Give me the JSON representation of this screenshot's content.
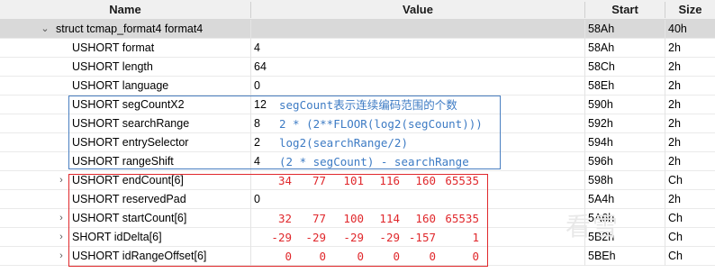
{
  "columns": {
    "name": "Name",
    "value": "Value",
    "start": "Start",
    "size": "Size"
  },
  "rows": [
    {
      "name": "struct tcmap_format4 format4",
      "value": "",
      "start": "58Ah",
      "size": "40h"
    },
    {
      "name": "USHORT format",
      "value": "4",
      "start": "58Ah",
      "size": "2h"
    },
    {
      "name": "USHORT length",
      "value": "64",
      "start": "58Ch",
      "size": "2h"
    },
    {
      "name": "USHORT language",
      "value": "0",
      "start": "58Eh",
      "size": "2h"
    },
    {
      "name": "USHORT segCountX2",
      "value": "12",
      "start": "590h",
      "size": "2h"
    },
    {
      "name": "USHORT searchRange",
      "value": "8",
      "start": "592h",
      "size": "2h"
    },
    {
      "name": "USHORT entrySelector",
      "value": "2",
      "start": "594h",
      "size": "2h"
    },
    {
      "name": "USHORT rangeShift",
      "value": "4",
      "start": "596h",
      "size": "2h"
    },
    {
      "name": "USHORT endCount[6]",
      "value": "",
      "start": "598h",
      "size": "Ch"
    },
    {
      "name": "USHORT reservedPad",
      "value": "0",
      "start": "5A4h",
      "size": "2h"
    },
    {
      "name": "USHORT startCount[6]",
      "value": "",
      "start": "5A6h",
      "size": "Ch"
    },
    {
      "name": "SHORT idDelta[6]",
      "value": "",
      "start": "5B2h",
      "size": "Ch"
    },
    {
      "name": "USHORT idRangeOffset[6]",
      "value": "",
      "start": "5BEh",
      "size": "Ch"
    }
  ],
  "notes": {
    "segCountX2": "segCount表示连续编码范围的个数",
    "searchRange": "2 * (2**FLOOR(log2(segCount)))",
    "entrySelector": "log2(searchRange/2)",
    "rangeShift": "(2 * segCount) - searchRange"
  },
  "arrays": {
    "endCount": [
      "34",
      "77",
      "101",
      "116",
      "160",
      "65535"
    ],
    "startCount": [
      "32",
      "77",
      "100",
      "114",
      "160",
      "65535"
    ],
    "idDelta": [
      "-29",
      "-29",
      "-29",
      "-29",
      "-157",
      "1"
    ],
    "idRangeOffset": [
      "0",
      "0",
      "0",
      "0",
      "0",
      "0"
    ]
  },
  "watermark": "看雪",
  "colors": {
    "note_blue": "#3d7bc4",
    "array_red": "#e0282c",
    "selected_row": "#d9d9d9"
  }
}
